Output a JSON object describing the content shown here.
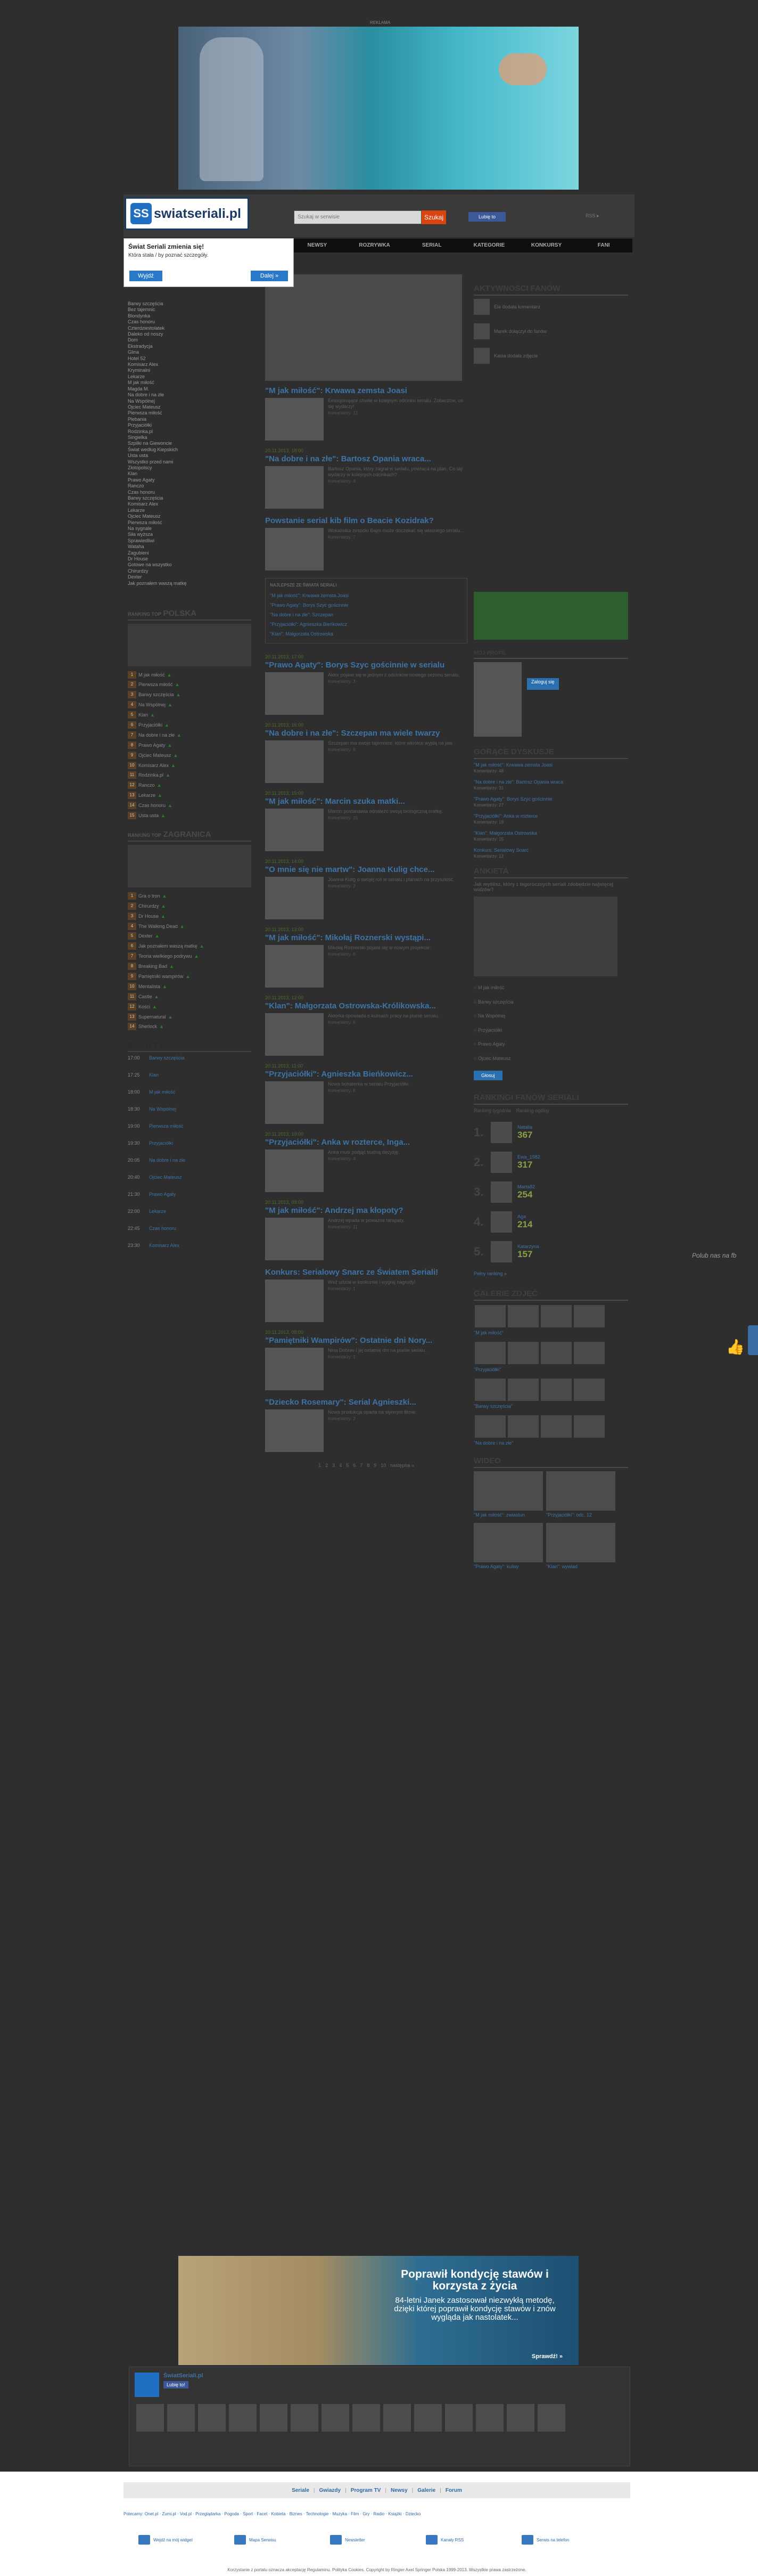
{
  "ad_label": "REKLAMA",
  "header": {
    "logo_text": "swiatseriali.pl",
    "logo_badge": "SS",
    "search_placeholder": "Szukaj w serwisie",
    "search_button": "Szukaj",
    "fb_button": "Lubię to",
    "right_text": "RSS ▸"
  },
  "nav": [
    "NEWSY",
    "ROZRYWKA",
    "SERIAL",
    "KATEGORIE",
    "KONKURSY",
    "FANI"
  ],
  "popup": {
    "title": "Świat Seriali zmienia się!",
    "subtitle": "Która stała / by poznać szczegóły.",
    "back": "Wyjdź",
    "next": "Dalej »"
  },
  "left": {
    "links": [
      "Barwy szczęścia",
      "Bez tajemnic",
      "Blondynka",
      "Czas honoru",
      "Czterdziestolatek",
      "Daleko od noszy",
      "Dom",
      "Ekstradycja",
      "Glina",
      "Hotel 52",
      "Komisarz Alex",
      "Kryminalni",
      "Lekarze",
      "M jak miłość",
      "Magda M.",
      "Na dobre i na złe",
      "Na Wspólnej",
      "Ojciec Mateusz",
      "Pierwsza miłość",
      "Plebania",
      "Przyjaciółki",
      "Rodzinka.pl",
      "Singielka",
      "Szpilki na Giewoncie",
      "Świat według Kiepskich",
      "Usta usta",
      "Wszystko przed nami",
      "Złotopolscy",
      "Klan",
      "Prawo Agaty",
      "Ranczo",
      "Czas honoru",
      "Barwy szczęścia",
      "Komisarz Alex",
      "Lekarze",
      "Ojciec Mateusz",
      "Pierwsza miłość",
      "Na sygnale",
      "Siła wyższa",
      "Sprawiedliwi",
      "Wataha",
      "Zagubieni",
      "Dr House",
      "Gotowe na wszystko",
      "Chirurdzy",
      "Dexter",
      "Jak poznałem waszą matkę"
    ],
    "pl_heading_prefix": "RANKING TOP",
    "pl_heading": "POLSKA",
    "pl_rank": [
      "M jak miłość",
      "Pierwsza miłość",
      "Barwy szczęścia",
      "Na Wspólnej",
      "Klan",
      "Przyjaciółki",
      "Na dobre i na złe",
      "Prawo Agaty",
      "Ojciec Mateusz",
      "Komisarz Alex",
      "Rodzinka.pl",
      "Ranczo",
      "Lekarze",
      "Czas honoru",
      "Usta usta"
    ],
    "intl_heading_prefix": "RANKING TOP",
    "intl_heading": "ZAGRANICA",
    "intl_rank": [
      "Gra o tron",
      "Chirurdzy",
      "Dr House",
      "The Walking Dead",
      "Dexter",
      "Jak poznałem waszą matkę",
      "Teoria wielkiego podrywu",
      "Breaking Bad",
      "Pamiętniki wampirów",
      "Mentalista",
      "Castle",
      "Kości",
      "Supernatural",
      "Sherlock"
    ],
    "tv_heading": "DZIŚ W TV",
    "tv_rows": [
      {
        "time": "17:00",
        "title": "Barwy szczęścia"
      },
      {
        "time": "17:25",
        "title": "Klan"
      },
      {
        "time": "18:00",
        "title": "M jak miłość"
      },
      {
        "time": "18:30",
        "title": "Na Wspólnej"
      },
      {
        "time": "19:00",
        "title": "Pierwsza miłość"
      },
      {
        "time": "19:30",
        "title": "Przyjaciółki"
      },
      {
        "time": "20:05",
        "title": "Na dobre i na złe"
      },
      {
        "time": "20:40",
        "title": "Ojciec Mateusz"
      },
      {
        "time": "21:30",
        "title": "Prawo Agaty"
      },
      {
        "time": "22:00",
        "title": "Lekarze"
      },
      {
        "time": "22:45",
        "title": "Czas honoru"
      },
      {
        "time": "23:30",
        "title": "Komisarz Alex"
      }
    ]
  },
  "articles": [
    {
      "date": "",
      "title": "\"M jak miłość\": Krwawa zemsta Joasi",
      "lead": "Emocjonujące chwile w kolejnym odcinku serialu. Zobaczcie, co się wydarzy!",
      "meta": "Komentarzy: 12"
    },
    {
      "date": "20.11.2013, 18:00",
      "title": "\"Na dobre i na złe\": Bartosz Opania wraca...",
      "lead": "Bartosz Opania, który zagrał w serialu, powraca na plan. Co się wydarzy w kolejnych odcinkach?",
      "meta": "Komentarzy: 4"
    },
    {
      "date": "",
      "title": "Powstanie serial kib film o Beacie Kozidrak?",
      "lead": "Wokalistka zespołu Bajm może doczekać się własnego serialu...",
      "meta": "Komentarzy: 7"
    },
    {
      "date": "20.11.2013, 17:00",
      "title": "\"Prawo Agaty\": Borys Szyc gościnnie w serialu",
      "lead": "Aktor pojawi się w jednym z odcinków nowego sezonu serialu.",
      "meta": "Komentarzy: 3"
    },
    {
      "date": "20.11.2013, 16:00",
      "title": "\"Na dobre i na złe\": Szczepan ma wiele twarzy",
      "lead": "Szczepan ma swoje tajemnice, które wkrótce wyjdą na jaw.",
      "meta": "Komentarzy: 9"
    },
    {
      "date": "20.11.2013, 15:00",
      "title": "\"M jak miłość\": Marcin szuka matki...",
      "lead": "Marcin postanawia odnaleźć swoją biologiczną matkę.",
      "meta": "Komentarzy: 15"
    },
    {
      "date": "20.11.2013, 14:00",
      "title": "\"O mnie się nie martw\": Joanna Kulig chce...",
      "lead": "Joanna Kulig o swojej roli w serialu i planach na przyszłość.",
      "meta": "Komentarzy: 2"
    },
    {
      "date": "20.11.2013, 13:00",
      "title": "\"M jak miłość\": Mikołaj Roznerski wystąpi...",
      "lead": "Mikołaj Roznerski pojawi się w nowym projekcie.",
      "meta": "Komentarzy: 6"
    },
    {
      "date": "20.11.2013, 12:00",
      "title": "\"Klan\": Małgorzata Ostrowska-Królikowska...",
      "lead": "Aktorka opowiada o kulisach pracy na planie serialu.",
      "meta": "Komentarzy: 5"
    },
    {
      "date": "20.11.2013, 11:00",
      "title": "\"Przyjaciółki\": Agnieszka Bieńkowicz...",
      "lead": "Nowa bohaterka w serialu Przyjaciółki.",
      "meta": "Komentarzy: 8"
    },
    {
      "date": "20.11.2013, 10:00",
      "title": "\"Przyjaciółki\": Anka w rozterce, Inga...",
      "lead": "Anka musi podjąć trudną decyzję.",
      "meta": "Komentarzy: 4"
    },
    {
      "date": "20.11.2013, 09:00",
      "title": "\"M jak miłość\": Andrzej ma kłopoty?",
      "lead": "Andrzej wpada w poważne tarapaty.",
      "meta": "Komentarzy: 11"
    },
    {
      "date": "",
      "title": "Konkurs: Serialowy Snarc ze Światem Seriali!",
      "lead": "Weź udział w konkursie i wygraj nagrody!",
      "meta": "Komentarzy: 1"
    },
    {
      "date": "20.11.2013, 08:00",
      "title": "\"Pamiętniki Wampirów\": Ostatnie dni Nory...",
      "lead": "Nina Dobrev i jej ostatnie dni na planie serialu.",
      "meta": "Komentarzy: 3"
    },
    {
      "date": "",
      "title": "\"Dziecko Rosemary\": Serial Agnieszki...",
      "lead": "Nowa produkcja oparta na słynnym filmie.",
      "meta": "Komentarzy: 2"
    }
  ],
  "news_box": {
    "heading": "NAJLEPSZE ZE ŚWIATA SERIALI",
    "items": [
      "\"M jak miłość\": Krwawa zemsta Joasi",
      "\"Prawo Agaty\": Borys Szyc gościnnie",
      "\"Na dobre i na złe\": Szczepan",
      "\"Przyjaciółki\": Agnieszka Bieńkowicz",
      "\"Klan\": Małgorzata Ostrowska"
    ]
  },
  "pagination": [
    "1",
    "2",
    "3",
    "4",
    "5",
    "6",
    "7",
    "8",
    "9",
    "10",
    "następna »"
  ],
  "right": {
    "activity_heading": "AKTYWNOŚCI FANÓW",
    "activity": [
      "Ela dodała komentarz",
      "Marek dołączył do fanów",
      "Kasia dodała zdjęcie"
    ],
    "profile_heading": "MÓJ PROFIL",
    "profile_btn": "Zaloguj się",
    "discussions_heading": "GORĄCE DYSKUSJE",
    "discussions": [
      {
        "t": "\"M jak miłość\": Krwawa zemsta Joasi",
        "m": "Komentarzy: 48"
      },
      {
        "t": "\"Na dobre i na złe\": Bartosz Opania wraca",
        "m": "Komentarzy: 31"
      },
      {
        "t": "\"Prawo Agaty\": Borys Szyc gościnnie",
        "m": "Komentarzy: 27"
      },
      {
        "t": "\"Przyjaciółki\": Anka w rozterce",
        "m": "Komentarzy: 19"
      },
      {
        "t": "\"Klan\": Małgorzata Ostrowska",
        "m": "Komentarzy: 15"
      },
      {
        "t": "Konkurs: Serialowy Snarc",
        "m": "Komentarzy: 12"
      }
    ],
    "poll_heading": "ANKIETA",
    "poll_question": "Jak myślisz, który z tegorocznych seriali zdobędzie najwięcej widzów?",
    "poll_options": [
      "M jak miłość",
      "Barwy szczęścia",
      "Na Wspólnej",
      "Przyjaciółki",
      "Prawo Agaty",
      "Ojciec Mateusz"
    ],
    "poll_btn": "Głosuj",
    "fans_heading": "RANKINGI FANÓW SERIALI",
    "fans_tabs": [
      "Ranking tygodnia",
      "Ranking ogólny"
    ],
    "fans": [
      {
        "n": "1.",
        "name": "Natalia",
        "pts": "367"
      },
      {
        "n": "2.",
        "name": "Ewa_1982",
        "pts": "317"
      },
      {
        "n": "3.",
        "name": "Marta82",
        "pts": "254"
      },
      {
        "n": "4.",
        "name": "Aga",
        "pts": "214"
      },
      {
        "n": "5.",
        "name": "Katarzyna",
        "pts": "157"
      }
    ],
    "fans_more": "Pełny ranking »",
    "gallery_heading": "GALERIE ZDJĘĆ",
    "galleries": [
      "\"M jak miłość\"",
      "\"Przyjaciółki\"",
      "\"Barwy szczęścia\"",
      "\"Na dobre i na złe\""
    ],
    "video_heading": "WIDEO",
    "videos": [
      "\"M jak miłość\": zwiastun",
      "\"Przyjaciółki\": odc. 12",
      "\"Prawo Agaty\": kulisy",
      "\"Klan\": wywiad"
    ]
  },
  "bottom_ad": {
    "headline": "Poprawił kondycję stawów i korzysta z życia",
    "body": "84-letni Janek zastosował niezwykłą metodę, dzięki której poprawił kondycję stawów i znów wygląda jak nastolatek...",
    "cta": "Sprawdź! »"
  },
  "fb_box": {
    "name": "ŚwiatSeriali.pl",
    "button": "Lubię to!"
  },
  "footer": {
    "nav": [
      "Seriale",
      "Gwiazdy",
      "Program TV",
      "Newsy",
      "Galerie",
      "Forum"
    ],
    "links": "Polecamy: Onet.pl · Zumi.pl · Vod.pl · Przeglądarka · Pogoda · Sport · Facet · Kobieta · Biznes · Technologie · Muzyka · Film · Gry · Radio · Książki · Dziecko",
    "tools": [
      "Wejdź na mój widget",
      "Mapa Serwisu",
      "Newsletter",
      "Kanały RSS",
      "Serwis na telefon"
    ],
    "copy": "Korzystanie z portalu oznacza akceptację Regulaminu. Polityka Cookies. Copyright by Ringier Axel Springer Polska 1999-2013. Wszystkie prawa zastrzeżone."
  },
  "side": {
    "widget_text": "Polub nas na fb"
  }
}
